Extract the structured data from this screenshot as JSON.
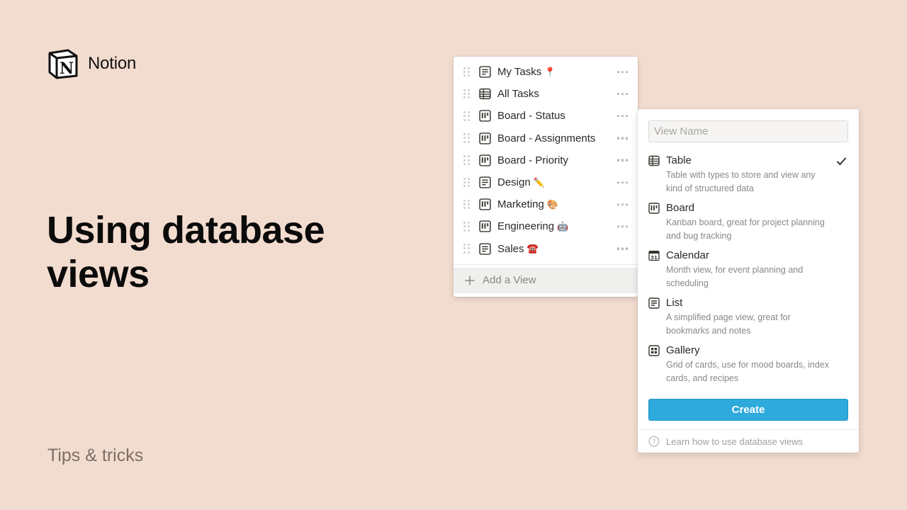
{
  "brand": {
    "name": "Notion",
    "logo_letter": "N"
  },
  "headline": "Using database views",
  "subtitle": "Tips & tricks",
  "views_panel": {
    "items": [
      {
        "label": "My Tasks",
        "icon": "list-icon",
        "emoji": "📍"
      },
      {
        "label": "All Tasks",
        "icon": "table-icon",
        "emoji": ""
      },
      {
        "label": "Board - Status",
        "icon": "board-icon",
        "emoji": ""
      },
      {
        "label": "Board - Assignments",
        "icon": "board-icon",
        "emoji": ""
      },
      {
        "label": "Board - Priority",
        "icon": "board-icon",
        "emoji": ""
      },
      {
        "label": "Design",
        "icon": "list-icon",
        "emoji": "✏️"
      },
      {
        "label": "Marketing",
        "icon": "board-icon",
        "emoji": "🎨"
      },
      {
        "label": "Engineering",
        "icon": "board-icon",
        "emoji": "🤖"
      },
      {
        "label": "Sales",
        "icon": "list-icon",
        "emoji": "☎️"
      }
    ],
    "add_view_label": "Add a View"
  },
  "create_panel": {
    "view_name_placeholder": "View Name",
    "view_name_value": "",
    "types": [
      {
        "title": "Table",
        "description": "Table with types to store and view any kind of structured data",
        "icon": "table-icon",
        "selected": true
      },
      {
        "title": "Board",
        "description": "Kanban board, great for project planning and bug tracking",
        "icon": "board-icon",
        "selected": false
      },
      {
        "title": "Calendar",
        "description": "Month view, for event planning and scheduling",
        "icon": "calendar-icon",
        "selected": false
      },
      {
        "title": "List",
        "description": "A simplified page view, great for bookmarks and notes",
        "icon": "list-icon",
        "selected": false
      },
      {
        "title": "Gallery",
        "description": "Grid of cards, use for mood boards, index cards, and recipes",
        "icon": "gallery-icon",
        "selected": false
      }
    ],
    "calendar_day": "31",
    "create_label": "Create",
    "learn_label": "Learn how to use database views"
  },
  "colors": {
    "background": "#f2dccf",
    "accent": "#2eaadc",
    "subtitle": "#7d6f68"
  }
}
